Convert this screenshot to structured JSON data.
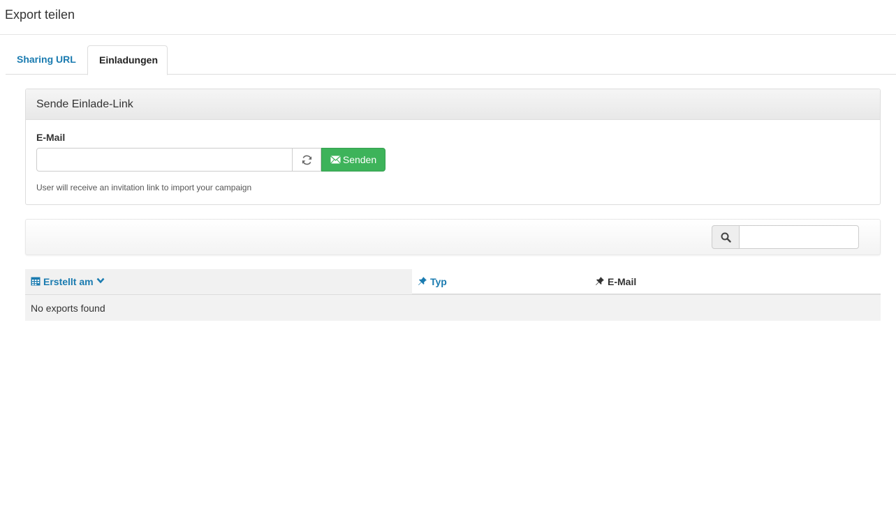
{
  "header": {
    "title": "Export teilen"
  },
  "tabs": [
    {
      "label": "Sharing URL",
      "active": false
    },
    {
      "label": "Einladungen",
      "active": true
    }
  ],
  "invite_panel": {
    "heading": "Sende Einlade-Link",
    "email_label": "E-Mail",
    "email_value": "",
    "email_placeholder": "",
    "send_label": "Senden",
    "help_text": "User will receive an invitation link to import your campaign"
  },
  "toolbar": {
    "search_value": "",
    "search_placeholder": ""
  },
  "table": {
    "columns": [
      {
        "label": "Erstellt am",
        "icon": "calendar-icon",
        "sort_icon": "chevron-down-icon"
      },
      {
        "label": "Typ",
        "icon": "pin-icon"
      },
      {
        "label": "E-Mail",
        "icon": "pin-icon"
      }
    ],
    "empty_message": "No exports found"
  },
  "colors": {
    "link": "#1a7bb0",
    "success": "#3db35a",
    "border": "#dddddd"
  }
}
